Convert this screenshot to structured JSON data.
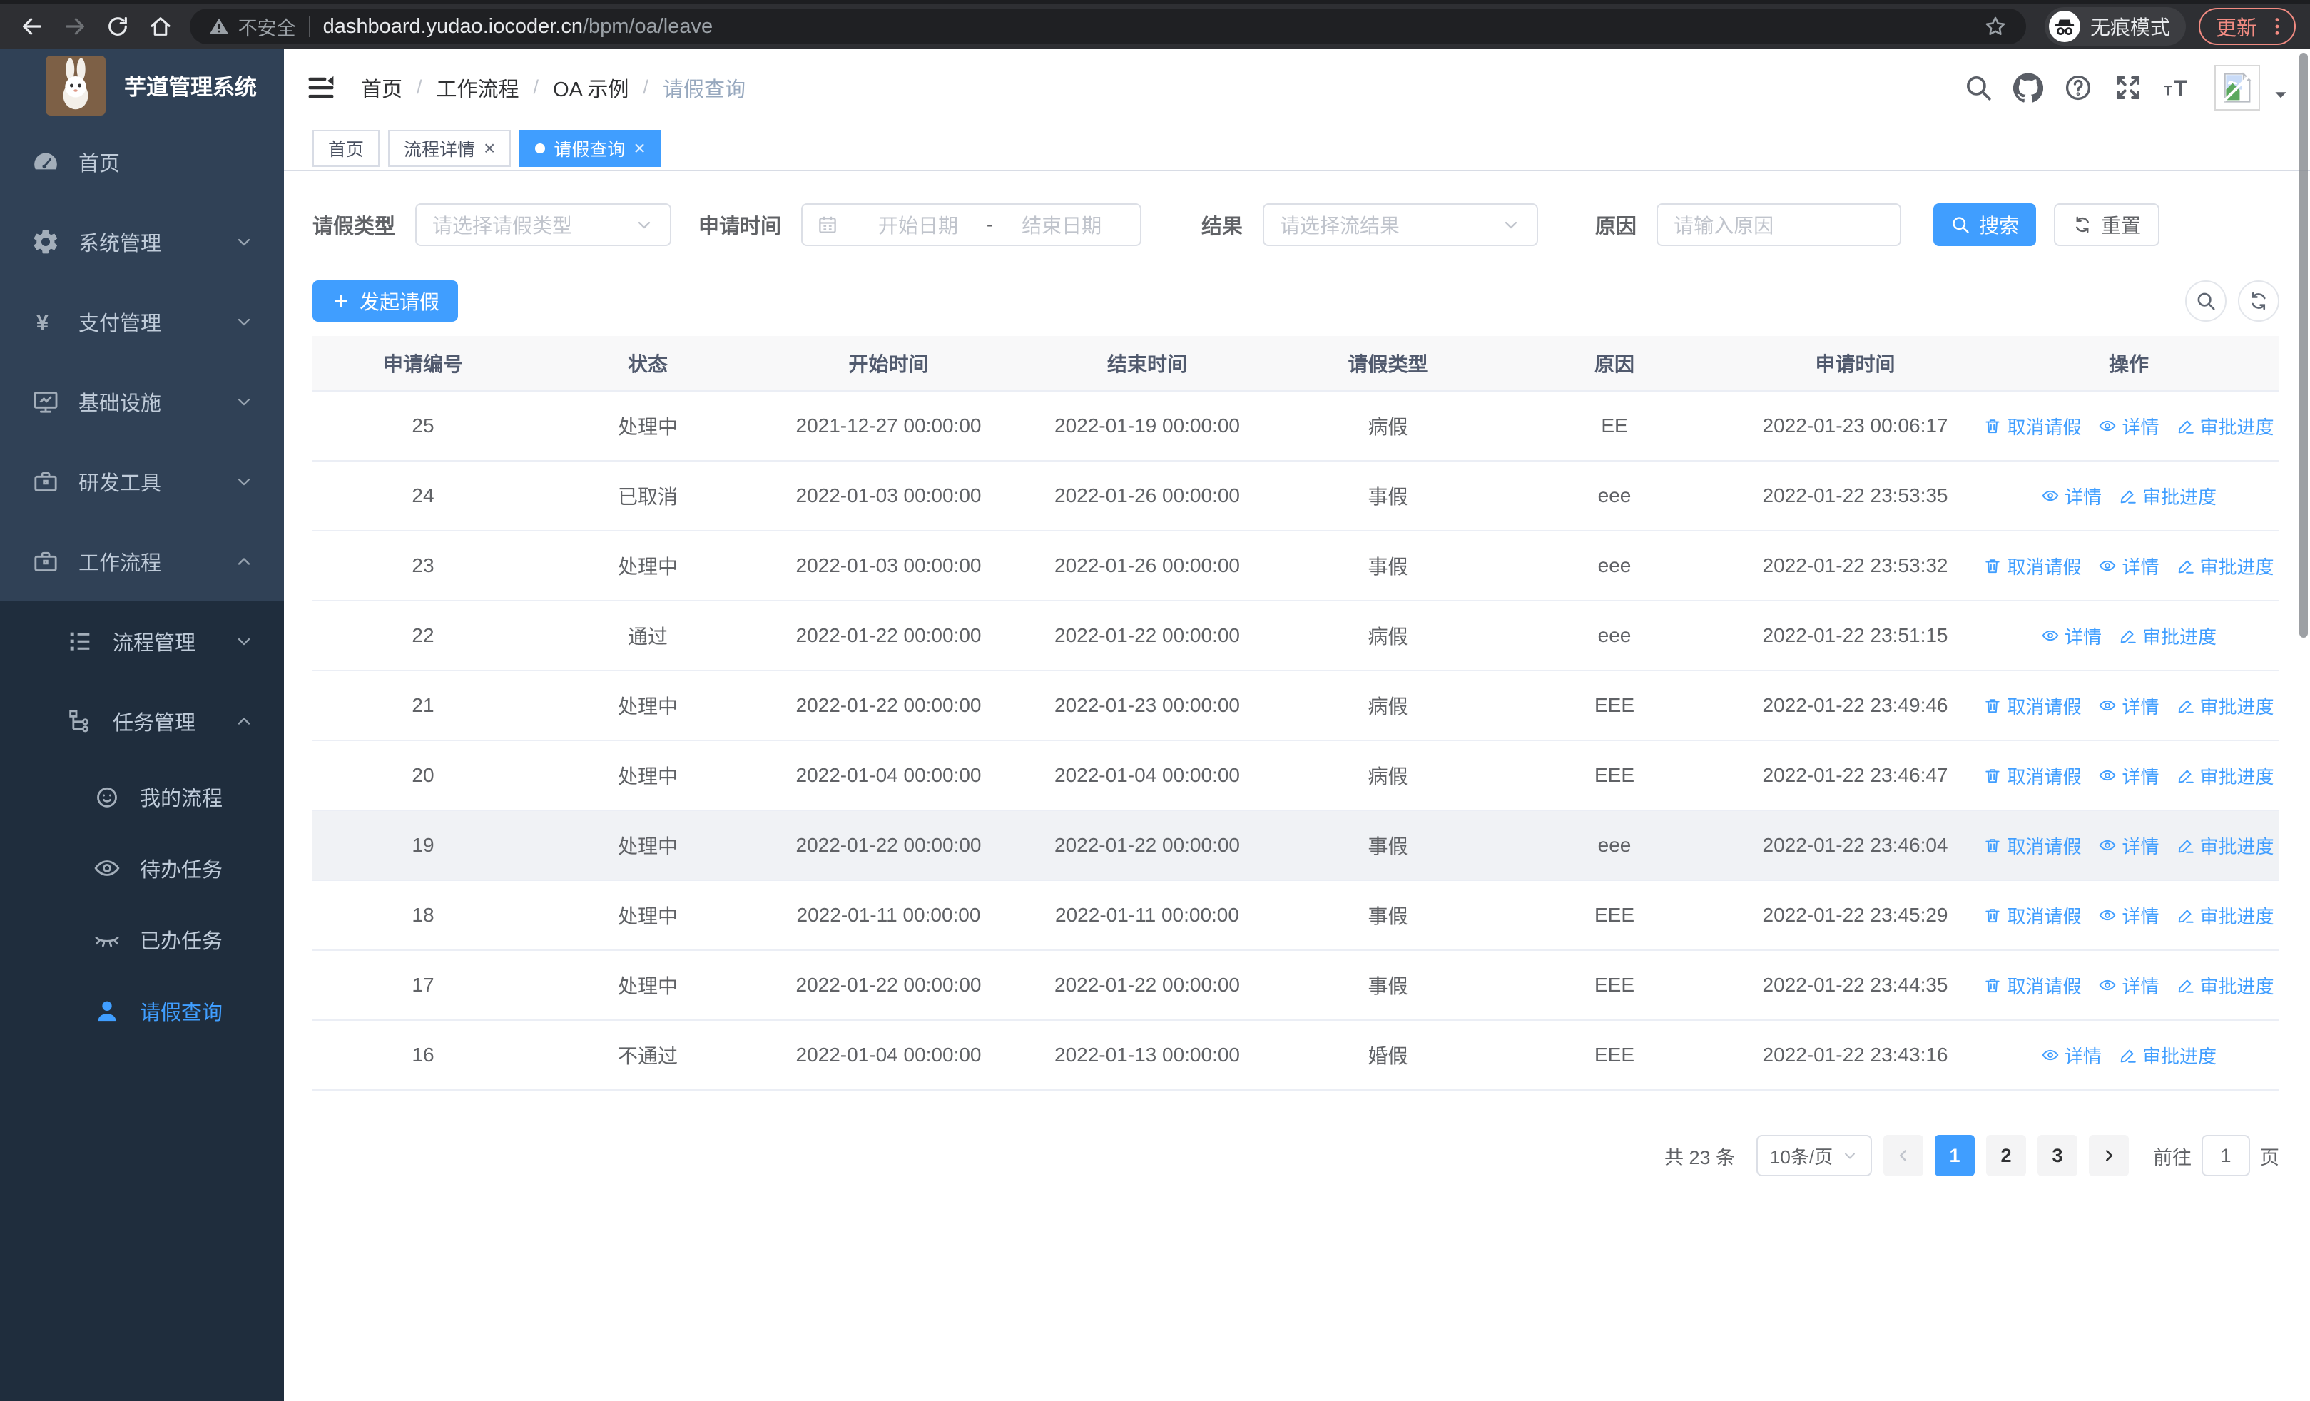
{
  "browser": {
    "security_label": "不安全",
    "url_host": "dashboard.yudao.iocoder.cn",
    "url_path": "/bpm/oa/leave",
    "incognito_label": "无痕模式",
    "update_label": "更新"
  },
  "sidebar": {
    "app_title": "芋道管理系统",
    "items": [
      {
        "key": "home",
        "label": "首页",
        "icon": "dashboard-icon",
        "depth": 0
      },
      {
        "key": "system",
        "label": "系统管理",
        "icon": "gear-icon",
        "depth": 0,
        "arrow": "down"
      },
      {
        "key": "payment",
        "label": "支付管理",
        "icon": "yen-icon",
        "depth": 0,
        "arrow": "down"
      },
      {
        "key": "infra",
        "label": "基础设施",
        "icon": "monitor-icon",
        "depth": 0,
        "arrow": "down"
      },
      {
        "key": "devtool",
        "label": "研发工具",
        "icon": "briefcase-icon",
        "depth": 0,
        "arrow": "down"
      },
      {
        "key": "workflow",
        "label": "工作流程",
        "icon": "briefcase-icon",
        "depth": 0,
        "arrow": "up"
      },
      {
        "key": "process-mgmt",
        "label": "流程管理",
        "icon": "list-tree-icon",
        "depth": 1,
        "arrow": "down"
      },
      {
        "key": "task-mgmt",
        "label": "任务管理",
        "icon": "tree-icon",
        "depth": 1,
        "arrow": "up"
      },
      {
        "key": "my-process",
        "label": "我的流程",
        "icon": "face-icon",
        "depth": 2
      },
      {
        "key": "todo-task",
        "label": "待办任务",
        "icon": "eye-open-icon",
        "depth": 2
      },
      {
        "key": "done-task",
        "label": "已办任务",
        "icon": "eye-closed-icon",
        "depth": 2
      },
      {
        "key": "leave-query",
        "label": "请假查询",
        "icon": "user-icon",
        "depth": 2,
        "active": true
      }
    ]
  },
  "breadcrumb": [
    "首页",
    "工作流程",
    "OA 示例",
    "请假查询"
  ],
  "tabs": [
    {
      "label": "首页",
      "closable": false,
      "active": false
    },
    {
      "label": "流程详情",
      "closable": true,
      "active": false
    },
    {
      "label": "请假查询",
      "closable": true,
      "active": true
    }
  ],
  "filters": {
    "leave_type_label": "请假类型",
    "leave_type_placeholder": "请选择请假类型",
    "apply_time_label": "申请时间",
    "date_start_placeholder": "开始日期",
    "date_separator": "-",
    "date_end_placeholder": "结束日期",
    "result_label": "结果",
    "result_placeholder": "请选择流结果",
    "reason_label": "原因",
    "reason_placeholder": "请输入原因",
    "search_label": "搜索",
    "reset_label": "重置"
  },
  "toolbar": {
    "create_label": "发起请假"
  },
  "table": {
    "columns": [
      "申请编号",
      "状态",
      "开始时间",
      "结束时间",
      "请假类型",
      "原因",
      "申请时间",
      "操作"
    ],
    "action_labels": {
      "cancel": "取消请假",
      "detail": "详情",
      "progress": "审批进度"
    },
    "rows": [
      {
        "id": "25",
        "status": "处理中",
        "start": "2021-12-27 00:00:00",
        "end": "2022-01-19 00:00:00",
        "type": "病假",
        "reason": "EE",
        "apply_time": "2022-01-23 00:06:17",
        "actions": [
          "cancel",
          "detail",
          "progress"
        ]
      },
      {
        "id": "24",
        "status": "已取消",
        "start": "2022-01-03 00:00:00",
        "end": "2022-01-26 00:00:00",
        "type": "事假",
        "reason": "eee",
        "apply_time": "2022-01-22 23:53:35",
        "actions": [
          "detail",
          "progress"
        ]
      },
      {
        "id": "23",
        "status": "处理中",
        "start": "2022-01-03 00:00:00",
        "end": "2022-01-26 00:00:00",
        "type": "事假",
        "reason": "eee",
        "apply_time": "2022-01-22 23:53:32",
        "actions": [
          "cancel",
          "detail",
          "progress"
        ]
      },
      {
        "id": "22",
        "status": "通过",
        "start": "2022-01-22 00:00:00",
        "end": "2022-01-22 00:00:00",
        "type": "病假",
        "reason": "eee",
        "apply_time": "2022-01-22 23:51:15",
        "actions": [
          "detail",
          "progress"
        ]
      },
      {
        "id": "21",
        "status": "处理中",
        "start": "2022-01-22 00:00:00",
        "end": "2022-01-23 00:00:00",
        "type": "病假",
        "reason": "EEE",
        "apply_time": "2022-01-22 23:49:46",
        "actions": [
          "cancel",
          "detail",
          "progress"
        ]
      },
      {
        "id": "20",
        "status": "处理中",
        "start": "2022-01-04 00:00:00",
        "end": "2022-01-04 00:00:00",
        "type": "病假",
        "reason": "EEE",
        "apply_time": "2022-01-22 23:46:47",
        "actions": [
          "cancel",
          "detail",
          "progress"
        ]
      },
      {
        "id": "19",
        "status": "处理中",
        "start": "2022-01-22 00:00:00",
        "end": "2022-01-22 00:00:00",
        "type": "事假",
        "reason": "eee",
        "apply_time": "2022-01-22 23:46:04",
        "actions": [
          "cancel",
          "detail",
          "progress"
        ],
        "highlight": true
      },
      {
        "id": "18",
        "status": "处理中",
        "start": "2022-01-11 00:00:00",
        "end": "2022-01-11 00:00:00",
        "type": "事假",
        "reason": "EEE",
        "apply_time": "2022-01-22 23:45:29",
        "actions": [
          "cancel",
          "detail",
          "progress"
        ]
      },
      {
        "id": "17",
        "status": "处理中",
        "start": "2022-01-22 00:00:00",
        "end": "2022-01-22 00:00:00",
        "type": "事假",
        "reason": "EEE",
        "apply_time": "2022-01-22 23:44:35",
        "actions": [
          "cancel",
          "detail",
          "progress"
        ]
      },
      {
        "id": "16",
        "status": "不通过",
        "start": "2022-01-04 00:00:00",
        "end": "2022-01-13 00:00:00",
        "type": "婚假",
        "reason": "EEE",
        "apply_time": "2022-01-22 23:43:16",
        "actions": [
          "detail",
          "progress"
        ]
      }
    ]
  },
  "pagination": {
    "total_label": "共 23 条",
    "page_size": "10条/页",
    "pages": [
      "1",
      "2",
      "3"
    ],
    "active_page": "1",
    "goto_label": "前往",
    "goto_value": "1",
    "page_unit": "页"
  },
  "colors": {
    "primary": "#409eff",
    "sidebar_bg": "#304156",
    "submenu_bg": "#1f2d3d",
    "update_accent": "#f28b82"
  }
}
